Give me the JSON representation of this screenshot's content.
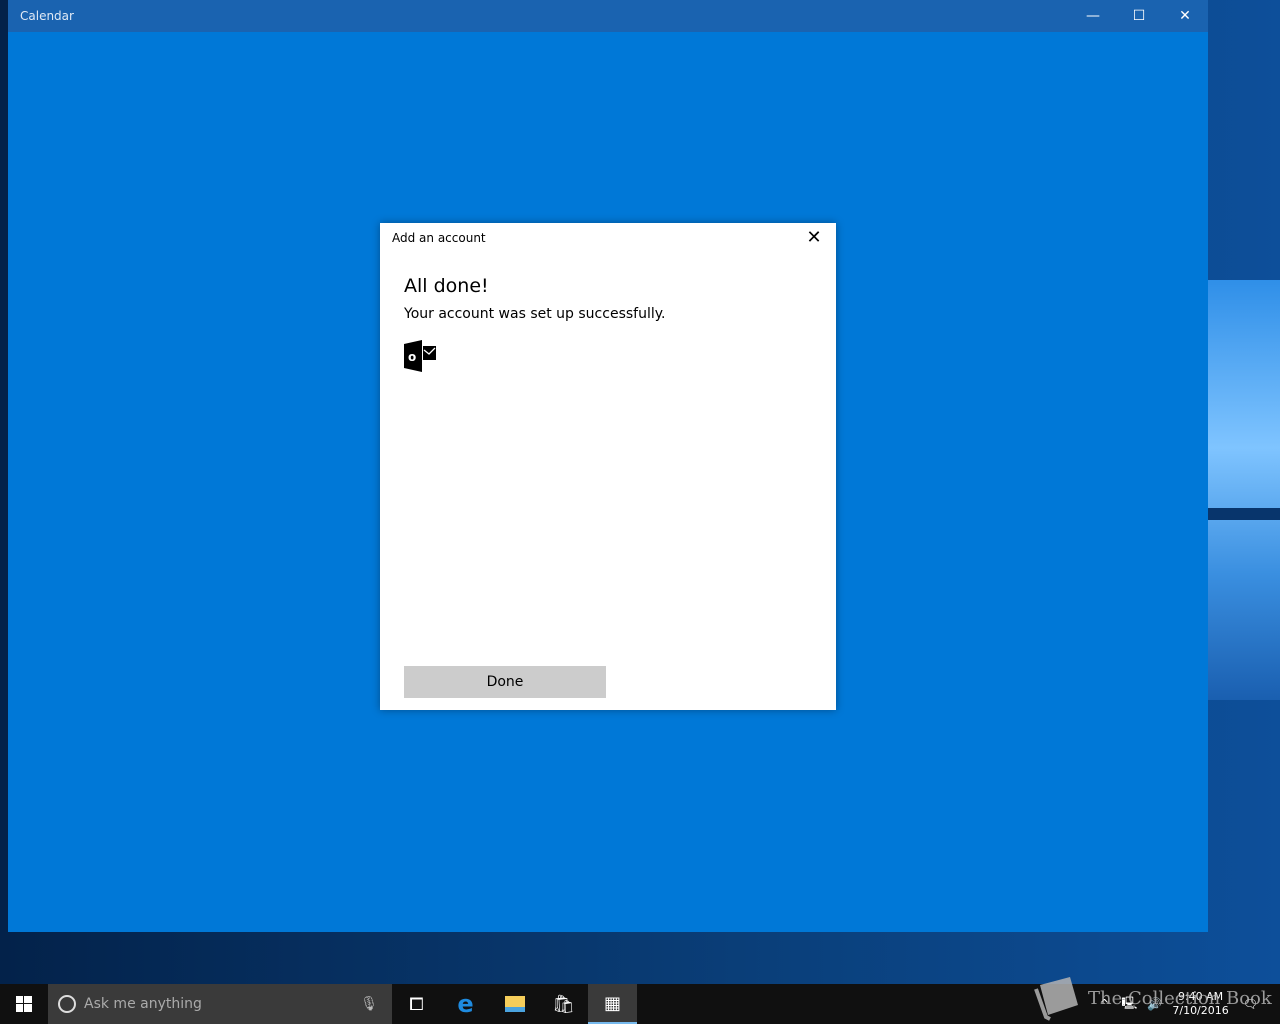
{
  "window": {
    "title": "Calendar",
    "minimize": "—",
    "maximize": "☐",
    "close": "✕"
  },
  "dialog": {
    "title": "Add an account",
    "close": "✕",
    "heading": "All done!",
    "message": "Your account was set up successfully.",
    "icon": "outlook-icon",
    "icon_letter": "o",
    "done_label": "Done"
  },
  "taskbar": {
    "search_placeholder": "Ask me anything",
    "time": "9:40 AM",
    "date": "7/10/2016",
    "active_app": "calendar"
  },
  "watermark": "The Collection Book"
}
